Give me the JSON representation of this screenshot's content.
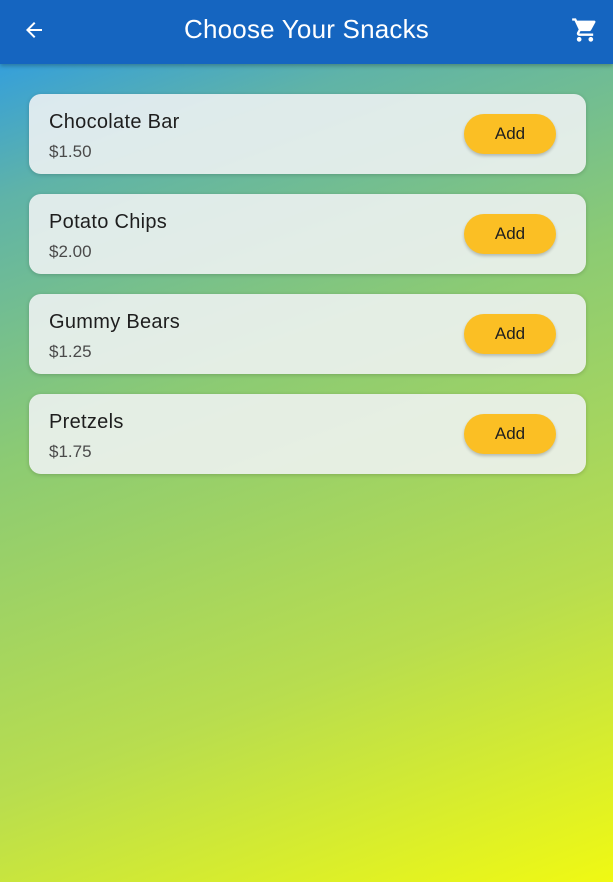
{
  "appbar": {
    "title": "Choose Your Snacks",
    "back_icon": "arrow-left-icon",
    "cart_icon": "shopping-cart-icon",
    "background_color": "#1565c0"
  },
  "snacks": [
    {
      "name": "Chocolate Bar",
      "price": "$1.50",
      "button_label": "Add"
    },
    {
      "name": "Potato Chips",
      "price": "$2.00",
      "button_label": "Add"
    },
    {
      "name": "Gummy Bears",
      "price": "$1.25",
      "button_label": "Add"
    },
    {
      "name": "Pretzels",
      "price": "$1.75",
      "button_label": "Add"
    }
  ],
  "colors": {
    "accent_button": "#fbbf24",
    "gradient_start": "#2196f3",
    "gradient_end": "#f0f913"
  }
}
